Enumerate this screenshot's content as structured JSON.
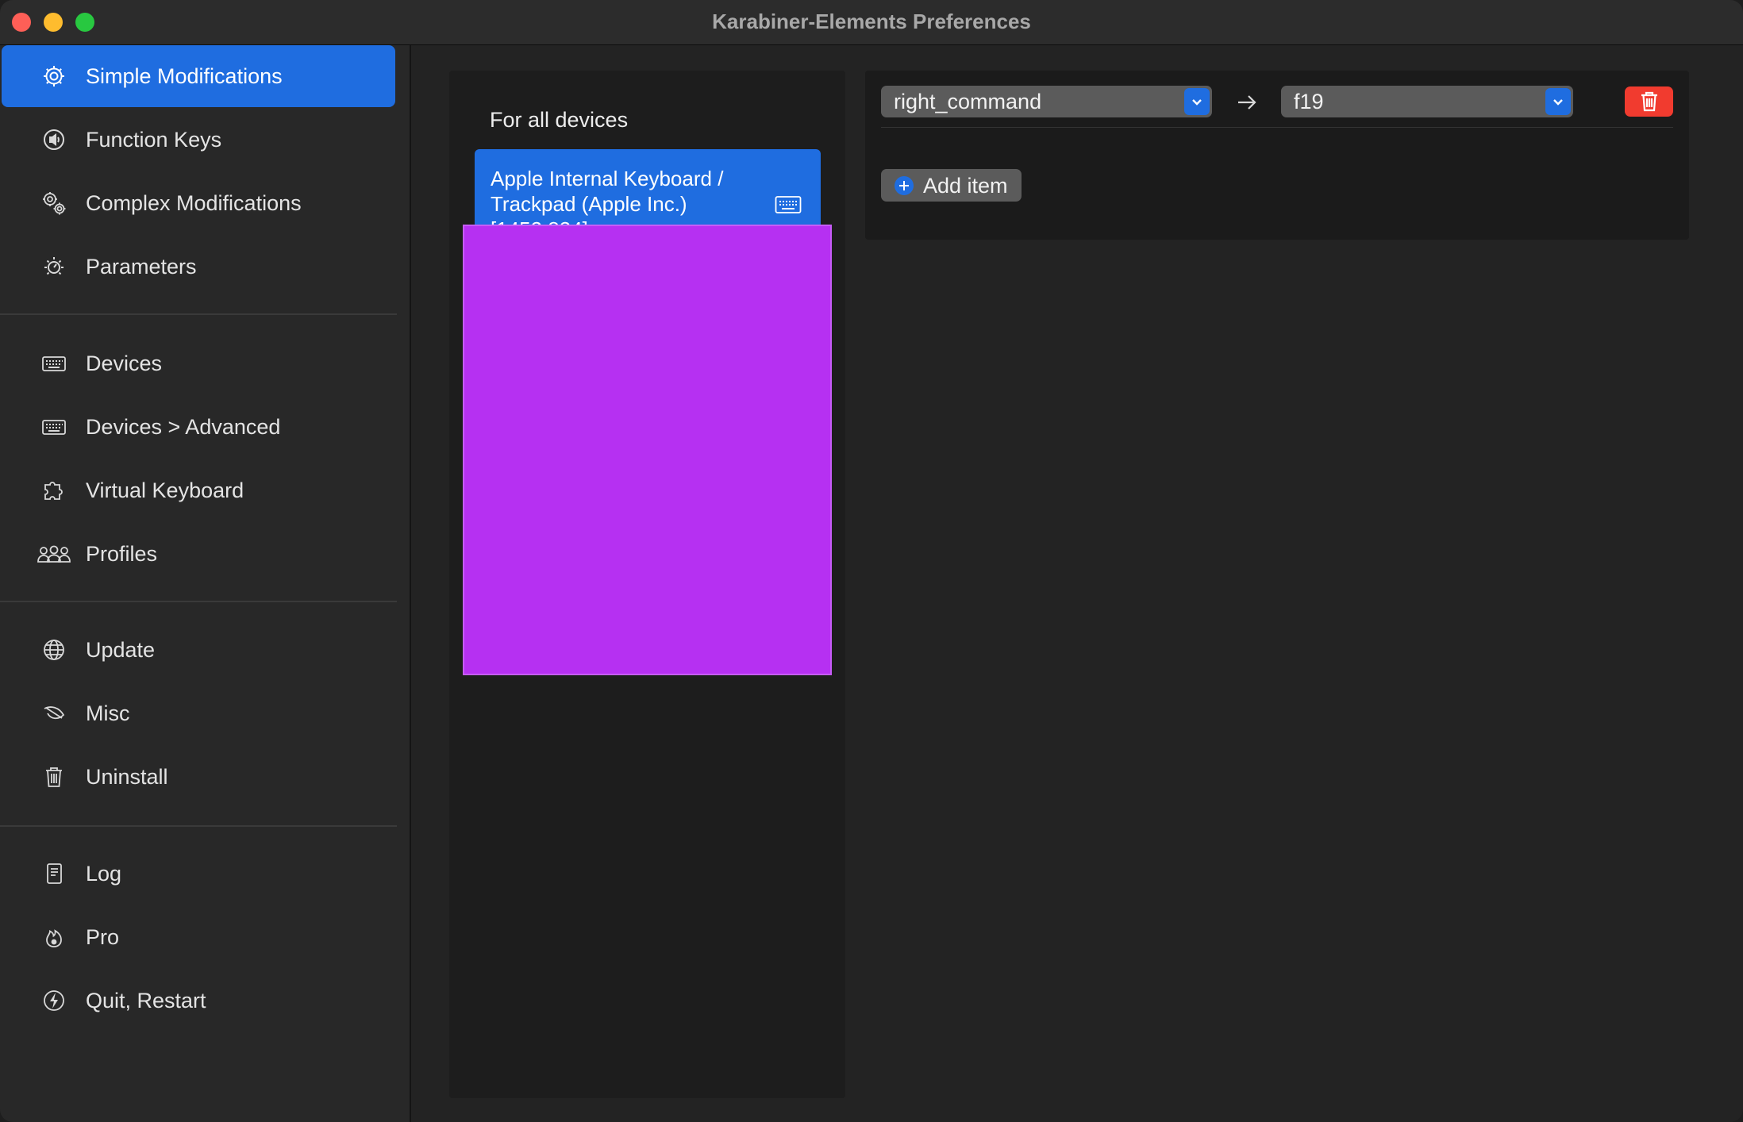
{
  "window": {
    "title": "Karabiner-Elements Preferences"
  },
  "sidebar": {
    "items": [
      {
        "label": "Simple Modifications",
        "icon": "gear-icon",
        "active": true
      },
      {
        "label": "Function Keys",
        "icon": "speaker-icon"
      },
      {
        "label": "Complex Modifications",
        "icon": "gears-icon"
      },
      {
        "label": "Parameters",
        "icon": "sun-gauge-icon"
      },
      {
        "label": "Devices",
        "icon": "keyboard-icon"
      },
      {
        "label": "Devices > Advanced",
        "icon": "keyboard-icon"
      },
      {
        "label": "Virtual Keyboard",
        "icon": "puzzle-icon"
      },
      {
        "label": "Profiles",
        "icon": "people-icon"
      },
      {
        "label": "Update",
        "icon": "globe-icon"
      },
      {
        "label": "Misc",
        "icon": "leaf-icon"
      },
      {
        "label": "Uninstall",
        "icon": "trash-icon"
      },
      {
        "label": "Log",
        "icon": "document-icon"
      },
      {
        "label": "Pro",
        "icon": "flame-icon"
      },
      {
        "label": "Quit, Restart",
        "icon": "bolt-icon"
      }
    ]
  },
  "devices": {
    "heading": "For all devices",
    "selected": {
      "line1": "Apple Internal Keyboard /",
      "line2": "Trackpad (Apple Inc.)",
      "line3": "[1452,834]"
    }
  },
  "mapping": {
    "from": "right_command",
    "to": "f19",
    "add_label": "Add item"
  },
  "colors": {
    "accent": "#1f6de0",
    "delete": "#f13b2f",
    "redaction": "#b630f2"
  }
}
